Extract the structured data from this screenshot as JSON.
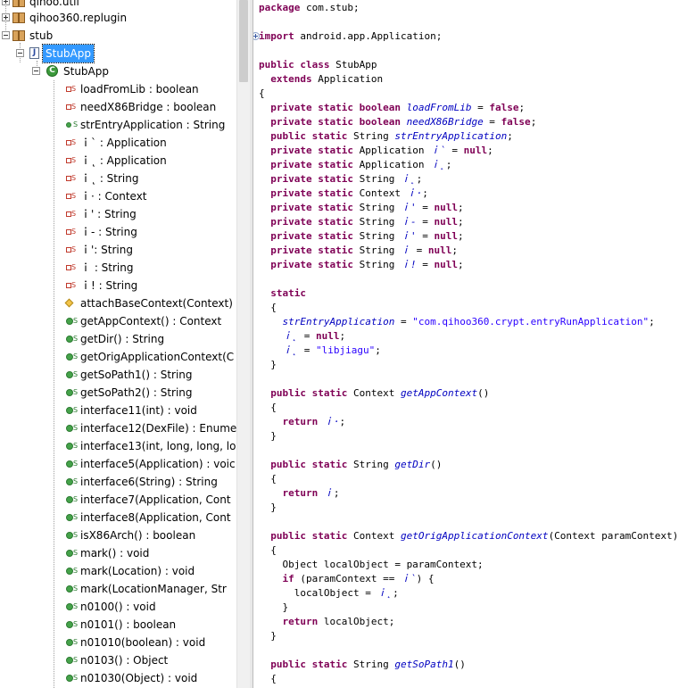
{
  "tree": {
    "packages": [
      "qihoo.util",
      "qihoo360.replugin",
      "stub"
    ],
    "file": "StubApp",
    "class": "StubApp",
    "members": [
      {
        "kind": "field-private",
        "label": "loadFromLib : boolean"
      },
      {
        "kind": "field-private",
        "label": "needX86Bridge : boolean"
      },
      {
        "kind": "field-public",
        "label": "strEntryApplication : String"
      },
      {
        "kind": "field-private",
        "label": "ｉ` : Application"
      },
      {
        "kind": "field-private",
        "label": "ｉ˛ : Application"
      },
      {
        "kind": "field-private",
        "label": "ｉ˛ : String"
      },
      {
        "kind": "field-private",
        "label": "ｉ· : Context"
      },
      {
        "kind": "field-private",
        "label": "ｉ' : String"
      },
      {
        "kind": "field-private",
        "label": "ｉ- : String"
      },
      {
        "kind": "field-private",
        "label": "ｉ': String"
      },
      {
        "kind": "field-private",
        "label": "ｉ : String"
      },
      {
        "kind": "field-private",
        "label": "ｉ! : String"
      },
      {
        "kind": "method-protected",
        "label": "attachBaseContext(Context)"
      },
      {
        "kind": "method-public",
        "label": "getAppContext() : Context"
      },
      {
        "kind": "method-public",
        "label": "getDir() : String"
      },
      {
        "kind": "method-public",
        "label": "getOrigApplicationContext(C"
      },
      {
        "kind": "method-public",
        "label": "getSoPath1() : String"
      },
      {
        "kind": "method-public",
        "label": "getSoPath2() : String"
      },
      {
        "kind": "method-public",
        "label": "interface11(int) : void"
      },
      {
        "kind": "method-public",
        "label": "interface12(DexFile) : Enume"
      },
      {
        "kind": "method-public",
        "label": "interface13(int, long, long, lo"
      },
      {
        "kind": "method-public",
        "label": "interface5(Application) : voic"
      },
      {
        "kind": "method-public",
        "label": "interface6(String) : String"
      },
      {
        "kind": "method-public",
        "label": "interface7(Application, Cont"
      },
      {
        "kind": "method-public",
        "label": "interface8(Application, Cont"
      },
      {
        "kind": "method-public",
        "label": "isX86Arch() : boolean"
      },
      {
        "kind": "method-public",
        "label": "mark() : void"
      },
      {
        "kind": "method-public",
        "label": "mark(Location) : void"
      },
      {
        "kind": "method-public",
        "label": "mark(LocationManager, Str"
      },
      {
        "kind": "method-public",
        "label": "n0100() : void"
      },
      {
        "kind": "method-public",
        "label": "n0101() : boolean"
      },
      {
        "kind": "method-public",
        "label": "n01010(boolean) : void"
      },
      {
        "kind": "method-public",
        "label": "n0103() : Object"
      },
      {
        "kind": "method-public",
        "label": "n01030(Object) : void"
      }
    ]
  },
  "code": {
    "lines": [
      {
        "t": "package com.stub;"
      },
      {
        "t": ""
      },
      {
        "t": "import android.app.Application;",
        "fold": true
      },
      {
        "t": ""
      },
      {
        "t": "public class StubApp"
      },
      {
        "t": "  extends Application"
      },
      {
        "t": "{"
      },
      {
        "t": "  private static boolean loadFromLib = false;"
      },
      {
        "t": "  private static boolean needX86Bridge = false;"
      },
      {
        "t": "  public static String strEntryApplication;"
      },
      {
        "t": "  private static Application ｉ` = null;"
      },
      {
        "t": "  private static Application ｉ˛;"
      },
      {
        "t": "  private static String ｉ˛;"
      },
      {
        "t": "  private static Context ｉ·;"
      },
      {
        "t": "  private static String ｉ' = null;"
      },
      {
        "t": "  private static String ｉ- = null;"
      },
      {
        "t": "  private static String ｉ' = null;"
      },
      {
        "t": "  private static String ｉ = null;"
      },
      {
        "t": "  private static String ｉ! = null;"
      },
      {
        "t": ""
      },
      {
        "t": "  static"
      },
      {
        "t": "  {"
      },
      {
        "t": "    strEntryApplication = \"com.qihoo360.crypt.entryRunApplication\";"
      },
      {
        "t": "    ｉ˛ = null;"
      },
      {
        "t": "    ｉ˛ = \"libjiagu\";"
      },
      {
        "t": "  }"
      },
      {
        "t": ""
      },
      {
        "t": "  public static Context getAppContext()"
      },
      {
        "t": "  {"
      },
      {
        "t": "    return ｉ·;"
      },
      {
        "t": "  }"
      },
      {
        "t": ""
      },
      {
        "t": "  public static String getDir()"
      },
      {
        "t": "  {"
      },
      {
        "t": "    return ｉ;"
      },
      {
        "t": "  }"
      },
      {
        "t": ""
      },
      {
        "t": "  public static Context getOrigApplicationContext(Context paramContext)"
      },
      {
        "t": "  {"
      },
      {
        "t": "    Object localObject = paramContext;"
      },
      {
        "t": "    if (paramContext == ｉ`) {"
      },
      {
        "t": "      localObject = ｉ˛;"
      },
      {
        "t": "    }"
      },
      {
        "t": "    return localObject;"
      },
      {
        "t": "  }"
      },
      {
        "t": ""
      },
      {
        "t": "  public static String getSoPath1()"
      },
      {
        "t": "  {"
      }
    ]
  },
  "colors": {
    "keyword": "#7f0055",
    "field": "#0000c0",
    "string": "#2a00ff",
    "selection": "#3399ff"
  }
}
